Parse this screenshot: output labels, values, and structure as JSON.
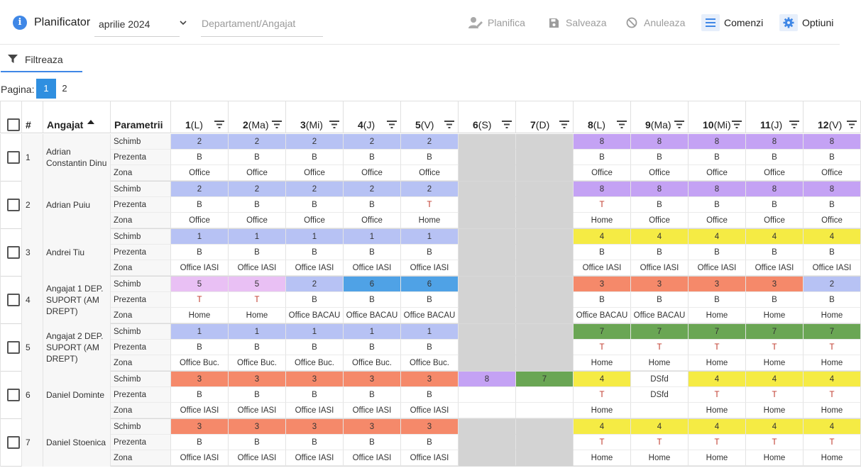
{
  "header": {
    "title": "Planificator",
    "month": "aprilie 2024",
    "dept_placeholder": "Departament/Angajat",
    "actions": [
      {
        "label": "Planifica",
        "icon": "user-edit-icon",
        "enabled": false
      },
      {
        "label": "Salveaza",
        "icon": "save-icon",
        "enabled": false
      },
      {
        "label": "Anuleaza",
        "icon": "cancel-icon",
        "enabled": false
      },
      {
        "label": "Comenzi",
        "icon": "menu-icon",
        "enabled": true
      },
      {
        "label": "Optiuni",
        "icon": "gear-icon",
        "enabled": true
      }
    ]
  },
  "filter_tab": "Filtreaza",
  "pagination": {
    "label": "Pagina:",
    "pages": [
      "1",
      "2"
    ],
    "current": "1"
  },
  "columns": {
    "index": "#",
    "employee": "Angajat",
    "params": "Parametrii",
    "days": [
      {
        "num": "1",
        "dow": "(L)"
      },
      {
        "num": "2",
        "dow": "(Ma)"
      },
      {
        "num": "3",
        "dow": "(Mi)"
      },
      {
        "num": "4",
        "dow": "(J)"
      },
      {
        "num": "5",
        "dow": "(V)"
      },
      {
        "num": "6",
        "dow": "(S)"
      },
      {
        "num": "7",
        "dow": "(D)"
      },
      {
        "num": "8",
        "dow": "(L)"
      },
      {
        "num": "9",
        "dow": "(Ma)"
      },
      {
        "num": "10",
        "dow": "(Mi)"
      },
      {
        "num": "11",
        "dow": "(J)"
      },
      {
        "num": "12",
        "dow": "(V)"
      }
    ]
  },
  "param_labels": [
    "Schimb",
    "Prezenta",
    "Zona"
  ],
  "colors": {
    "shift_1_2": "#b7c2f4",
    "shift_8": "#c4a2f4",
    "shift_4": "#f5eb44",
    "shift_3": "#f5896a",
    "shift_5": "#e9c0f4",
    "shift_6": "#4fa2e6",
    "shift_7": "#6aa654",
    "weekend": "#d3d3d3",
    "accent": "#3f87e6",
    "present_T": "#c0392b"
  },
  "employees": [
    {
      "idx": "1",
      "name": [
        "Adrian",
        "Constantin Dinu"
      ],
      "schimb": [
        "2",
        "2",
        "2",
        "2",
        "2",
        "",
        "",
        "8",
        "8",
        "8",
        "8",
        "8"
      ],
      "prezenta": [
        "B",
        "B",
        "B",
        "B",
        "B",
        "",
        "",
        "B",
        "B",
        "B",
        "B",
        "B"
      ],
      "zona": [
        "Office",
        "Office",
        "Office",
        "Office",
        "Office",
        "",
        "",
        "Office",
        "Office",
        "Office",
        "Office",
        "Office"
      ]
    },
    {
      "idx": "2",
      "name": [
        "Adrian Puiu"
      ],
      "schimb": [
        "2",
        "2",
        "2",
        "2",
        "2",
        "",
        "",
        "8",
        "8",
        "8",
        "8",
        "8"
      ],
      "prezenta": [
        "B",
        "B",
        "B",
        "B",
        "T",
        "",
        "",
        "T",
        "B",
        "B",
        "B",
        "B"
      ],
      "zona": [
        "Office",
        "Office",
        "Office",
        "Office",
        "Home",
        "",
        "",
        "Home",
        "Office",
        "Office",
        "Office",
        "Office"
      ]
    },
    {
      "idx": "3",
      "name": [
        "Andrei Tiu"
      ],
      "schimb": [
        "1",
        "1",
        "1",
        "1",
        "1",
        "",
        "",
        "4",
        "4",
        "4",
        "4",
        "4"
      ],
      "prezenta": [
        "B",
        "B",
        "B",
        "B",
        "B",
        "",
        "",
        "B",
        "B",
        "B",
        "B",
        "B"
      ],
      "zona": [
        "Office IASI",
        "Office IASI",
        "Office IASI",
        "Office IASI",
        "Office IASI",
        "",
        "",
        "Office IASI",
        "Office IASI",
        "Office IASI",
        "Office IASI",
        "Office IASI"
      ]
    },
    {
      "idx": "4",
      "name": [
        "Angajat 1 DEP.",
        "SUPORT (AM",
        "DREPT)"
      ],
      "schimb": [
        "5",
        "5",
        "2",
        "6",
        "6",
        "",
        "",
        "3",
        "3",
        "3",
        "3",
        "2"
      ],
      "prezenta": [
        "T",
        "T",
        "B",
        "B",
        "B",
        "",
        "",
        "B",
        "B",
        "B",
        "B",
        "B"
      ],
      "zona": [
        "Home",
        "Home",
        "Office BACAU",
        "Office BACAU",
        "Office BACAU",
        "",
        "",
        "Office BACAU",
        "Office BACAU",
        "Home",
        "Home",
        "Home"
      ]
    },
    {
      "idx": "5",
      "name": [
        "Angajat 2 DEP.",
        "SUPORT (AM",
        "DREPT)"
      ],
      "schimb": [
        "1",
        "1",
        "1",
        "1",
        "1",
        "",
        "",
        "7",
        "7",
        "7",
        "7",
        "7"
      ],
      "prezenta": [
        "B",
        "B",
        "B",
        "B",
        "B",
        "",
        "",
        "T",
        "T",
        "T",
        "T",
        "T"
      ],
      "zona": [
        "Office Buc.",
        "Office Buc.",
        "Office Buc.",
        "Office Buc.",
        "Office Buc.",
        "",
        "",
        "Home",
        "Home",
        "Home",
        "Home",
        "Home"
      ]
    },
    {
      "idx": "6",
      "name": [
        "Daniel Dominte"
      ],
      "schimb": [
        "3",
        "3",
        "3",
        "3",
        "3",
        "8",
        "7",
        "4",
        "DSfd",
        "4",
        "4",
        "4"
      ],
      "prezenta": [
        "B",
        "B",
        "B",
        "B",
        "B",
        "",
        "",
        "T",
        "DSfd",
        "T",
        "T",
        "T"
      ],
      "zona": [
        "Office IASI",
        "Office IASI",
        "Office IASI",
        "Office IASI",
        "Office IASI",
        "",
        "",
        "Home",
        "",
        "Home",
        "Home",
        "Home"
      ]
    },
    {
      "idx": "7",
      "name": [
        "Daniel Stoenica"
      ],
      "schimb": [
        "3",
        "3",
        "3",
        "3",
        "3",
        "",
        "",
        "4",
        "4",
        "4",
        "4",
        "4"
      ],
      "prezenta": [
        "B",
        "B",
        "B",
        "B",
        "B",
        "",
        "",
        "T",
        "T",
        "T",
        "T",
        "T"
      ],
      "zona": [
        "Office IASI",
        "Office IASI",
        "Office IASI",
        "Office IASI",
        "Office IASI",
        "",
        "",
        "Home",
        "Home",
        "Home",
        "Home",
        "Home"
      ]
    }
  ]
}
